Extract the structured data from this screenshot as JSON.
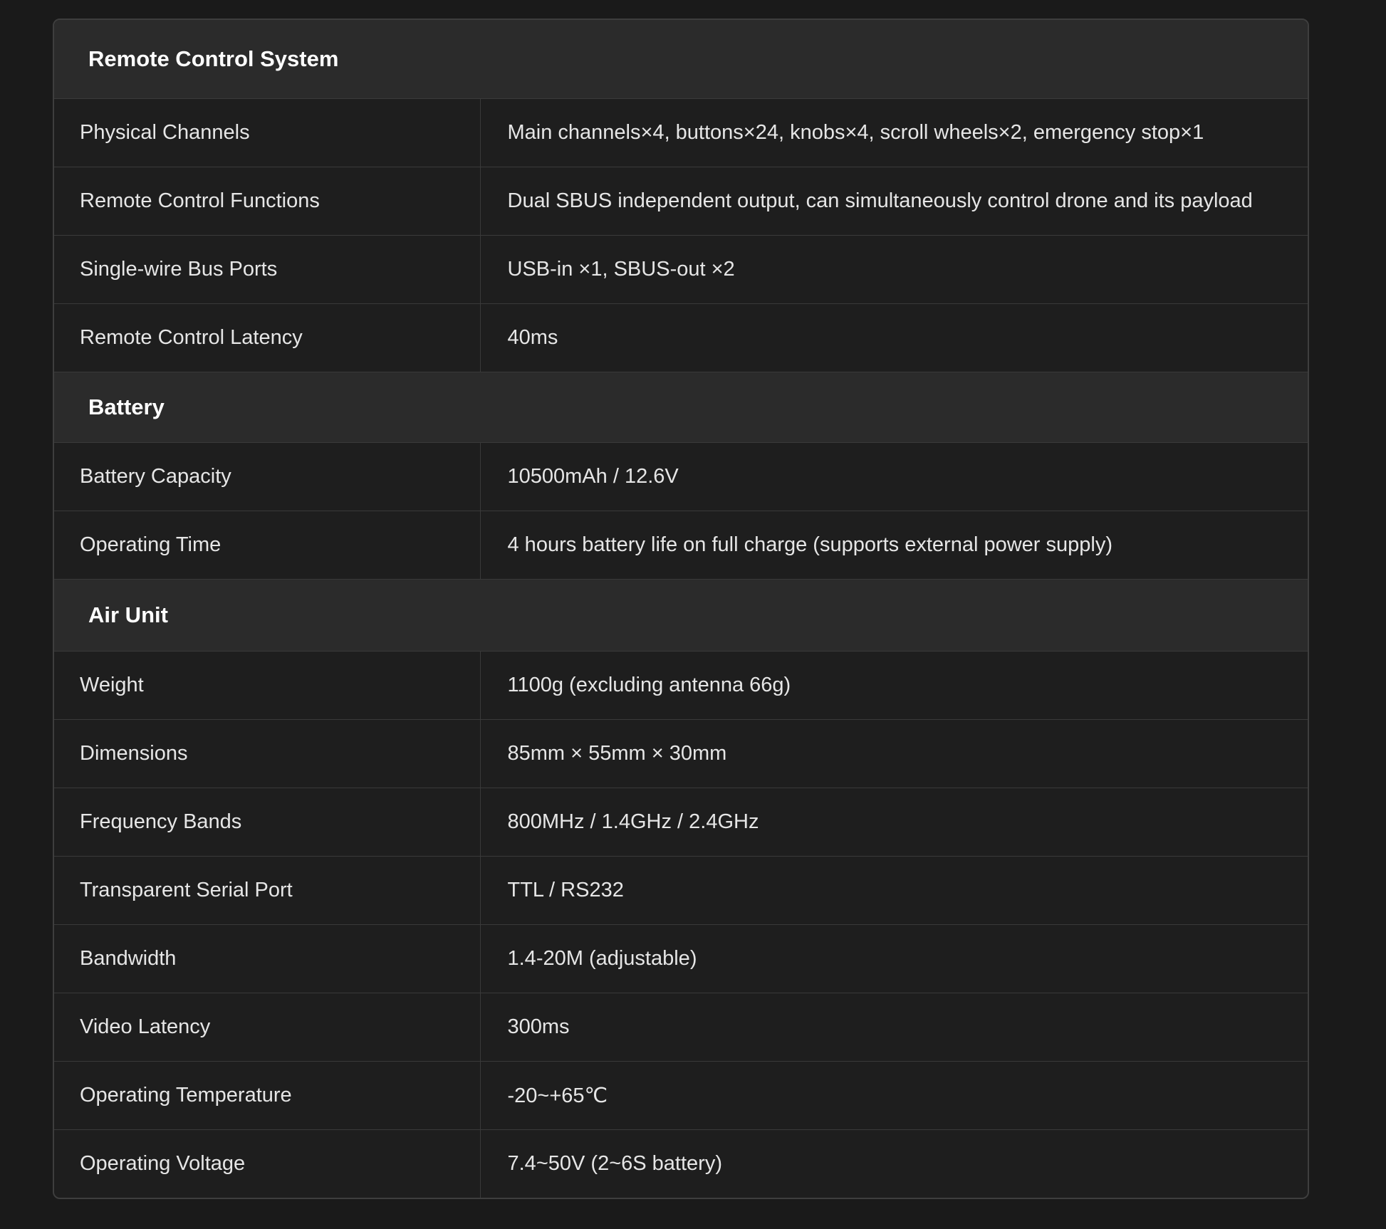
{
  "sections": [
    {
      "title": "Remote Control System",
      "rows": [
        {
          "label": "Physical Channels",
          "value": "Main channels×4, buttons×24, knobs×4, scroll wheels×2, emergency stop×1"
        },
        {
          "label": "Remote Control Functions",
          "value": "Dual SBUS independent output, can simultaneously control drone and its payload"
        },
        {
          "label": "Single-wire Bus Ports",
          "value": "USB-in ×1, SBUS-out ×2"
        },
        {
          "label": "Remote Control Latency",
          "value": "40ms"
        }
      ]
    },
    {
      "title": "Battery",
      "rows": [
        {
          "label": "Battery Capacity",
          "value": "10500mAh / 12.6V"
        },
        {
          "label": "Operating Time",
          "value": "4 hours battery life on full charge (supports external power supply)"
        }
      ]
    },
    {
      "title": "Air Unit",
      "rows": [
        {
          "label": "Weight",
          "value": "1100g (excluding antenna 66g)"
        },
        {
          "label": "Dimensions",
          "value": "85mm × 55mm × 30mm"
        },
        {
          "label": "Frequency Bands",
          "value": "800MHz / 1.4GHz / 2.4GHz"
        },
        {
          "label": "Transparent Serial Port",
          "value": "TTL / RS232"
        },
        {
          "label": "Bandwidth",
          "value": "1.4-20M (adjustable)"
        },
        {
          "label": "Video Latency",
          "value": "300ms"
        },
        {
          "label": "Operating Temperature",
          "value": "-20~+65℃"
        },
        {
          "label": "Operating Voltage",
          "value": "7.4~50V (2~6S battery)"
        }
      ]
    }
  ]
}
